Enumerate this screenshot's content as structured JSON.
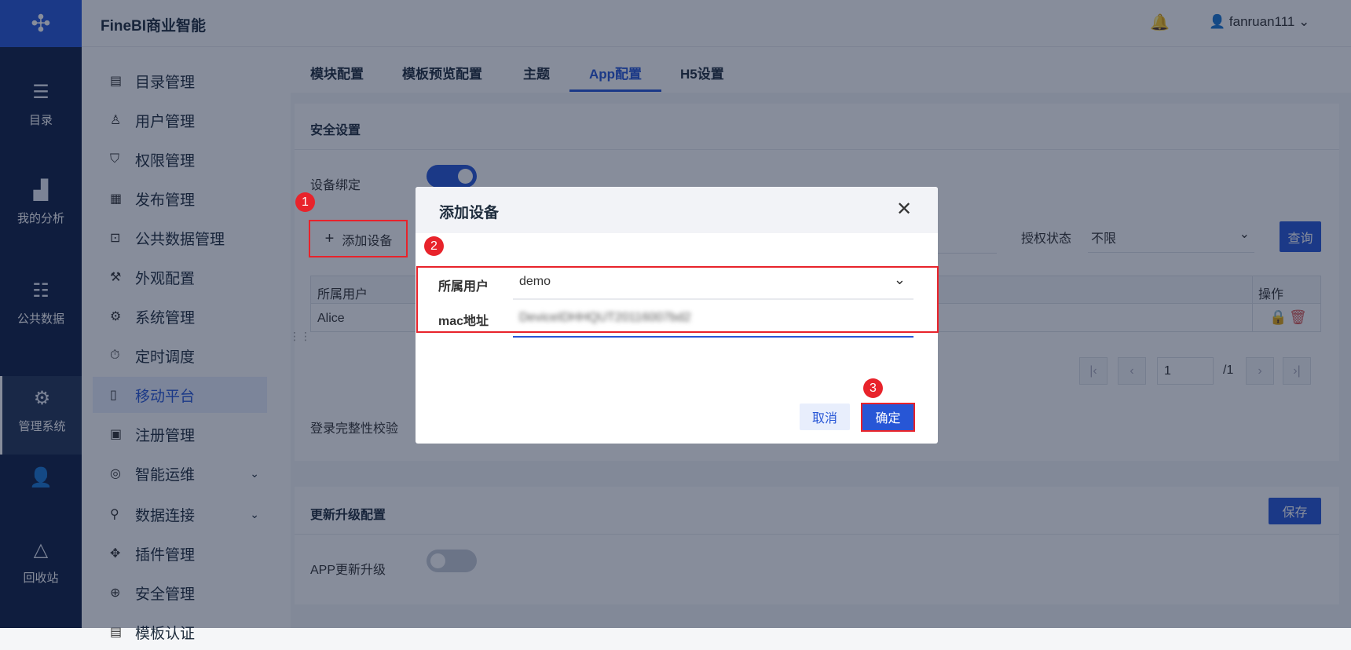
{
  "app": {
    "brand": "FineBI商业智能",
    "user": "fanruan111"
  },
  "rail": [
    {
      "label": "目录",
      "icon": "catalog-icon"
    },
    {
      "label": "我的分析",
      "icon": "analysis-icon"
    },
    {
      "label": "公共数据",
      "icon": "public-data-icon"
    },
    {
      "label": "管理系统",
      "icon": "management-icon"
    },
    {
      "label": "",
      "icon": "user-admin-icon"
    },
    {
      "label": "回收站",
      "icon": "recycle-icon"
    }
  ],
  "nav": [
    {
      "label": "目录管理"
    },
    {
      "label": "用户管理"
    },
    {
      "label": "权限管理"
    },
    {
      "label": "发布管理"
    },
    {
      "label": "公共数据管理"
    },
    {
      "label": "外观配置"
    },
    {
      "label": "系统管理"
    },
    {
      "label": "定时调度"
    },
    {
      "label": "移动平台"
    },
    {
      "label": "注册管理"
    },
    {
      "label": "智能运维"
    },
    {
      "label": "数据连接"
    },
    {
      "label": "插件管理"
    },
    {
      "label": "安全管理"
    },
    {
      "label": "模板认证"
    }
  ],
  "tabs": [
    "模块配置",
    "模板预览配置",
    "主题",
    "App配置",
    "H5设置"
  ],
  "security": {
    "title": "安全设置",
    "device_binding": "设备绑定",
    "add_device": "添加设备",
    "auth_status_label": "授权状态",
    "auth_status_value": "不限",
    "query": "查询",
    "login_check": "登录完整性校验"
  },
  "table": {
    "headers": [
      "所属用户",
      "操作"
    ],
    "rows": [
      [
        "Alice"
      ]
    ]
  },
  "pagination": {
    "page": "1",
    "total": "/1"
  },
  "update": {
    "title": "更新升级配置",
    "save": "保存",
    "app_update": "APP更新升级"
  },
  "modal": {
    "title": "添加设备",
    "user_label": "所属用户",
    "user_value": "demo",
    "mac_label": "mac地址",
    "mac_value": "DeviceIDHHQUT20116007bd2",
    "cancel": "取消",
    "confirm": "确定"
  },
  "annotations": [
    "1",
    "2",
    "3"
  ],
  "colors": {
    "accent": "#2756d6",
    "annotation": "#e8232b"
  }
}
